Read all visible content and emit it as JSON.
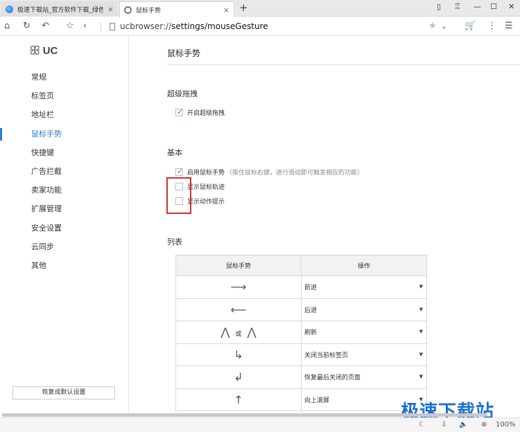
{
  "tabs": [
    {
      "title": "极速下载站_官方软件下载_绿色",
      "close": "×"
    },
    {
      "title": "鼠标手势",
      "close": "×"
    }
  ],
  "new_tab": "+",
  "window_controls": [
    "▯",
    "♖",
    "—",
    "☐",
    "✕"
  ],
  "address": {
    "url_scheme": "ucbrowser://",
    "url_path": "settings/mouseGesture"
  },
  "logo_text": "UC",
  "sidebar": {
    "items": [
      {
        "label": "常规",
        "active": false
      },
      {
        "label": "标签页",
        "active": false
      },
      {
        "label": "地址栏",
        "active": false
      },
      {
        "label": "鼠标手势",
        "active": true
      },
      {
        "label": "快捷键",
        "active": false
      },
      {
        "label": "广告拦截",
        "active": false
      },
      {
        "label": "卖家功能",
        "active": false
      },
      {
        "label": "扩展管理",
        "active": false
      },
      {
        "label": "安全设置",
        "active": false
      },
      {
        "label": "云同步",
        "active": false
      },
      {
        "label": "其他",
        "active": false
      }
    ],
    "reset_label": "恢复成默认设置"
  },
  "main": {
    "title": "鼠标手势",
    "super_drag": {
      "heading": "超级拖拽",
      "option": {
        "label": "开启超级拖拽",
        "checked": true
      }
    },
    "basic": {
      "heading": "基本",
      "options": [
        {
          "label": "启用鼠标手势",
          "hint": "（按住鼠标右键，进行滑动即可触发相应的功能）",
          "checked": true
        },
        {
          "label": "显示鼠标轨迹",
          "checked": false
        },
        {
          "label": "显示动作提示",
          "checked": false
        }
      ]
    },
    "list": {
      "heading": "列表",
      "col_gesture": "鼠标手势",
      "col_action": "操作",
      "or_text": "或",
      "rows": [
        {
          "gesture_icon": "arrow-right",
          "action": "前进"
        },
        {
          "gesture_icon": "arrow-left",
          "action": "后退"
        },
        {
          "gesture_icon": "up-down-or-up-down",
          "action": "刷新"
        },
        {
          "gesture_icon": "down-right",
          "action": "关闭当前标签页"
        },
        {
          "gesture_icon": "up-left",
          "action": "恢复最后关闭的页面"
        },
        {
          "gesture_icon": "arrow-up",
          "action": "向上滚屏"
        }
      ]
    }
  },
  "status": {
    "zoom": "100%"
  },
  "watermark": "极速下载站",
  "colors": {
    "accent": "#2f7bd7",
    "highlight_box": "#d0302e"
  }
}
